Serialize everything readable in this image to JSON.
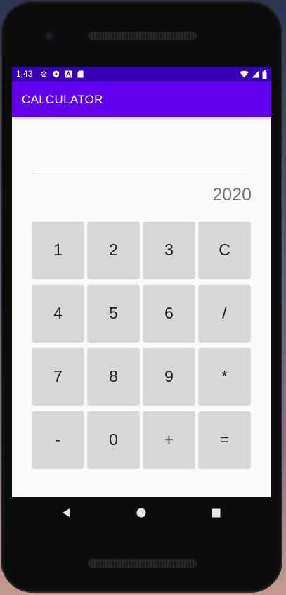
{
  "status_bar": {
    "time": "1:43",
    "left_icons": [
      "settings-icon",
      "shield-icon",
      "a-icon",
      "sd-card-icon"
    ],
    "right_icons": [
      "wifi-icon",
      "signal-icon",
      "battery-icon"
    ],
    "color": "#3700b3"
  },
  "app_bar": {
    "title": "CALCULATOR",
    "color": "#6200ee"
  },
  "display": {
    "input_value": "",
    "result": "2020"
  },
  "keypad": {
    "keys": [
      "1",
      "2",
      "3",
      "C",
      "4",
      "5",
      "6",
      "/",
      "7",
      "8",
      "9",
      "*",
      "-",
      "0",
      "+",
      "="
    ]
  },
  "nav_bar": {
    "buttons": [
      "back-icon",
      "home-icon",
      "recents-icon"
    ]
  }
}
